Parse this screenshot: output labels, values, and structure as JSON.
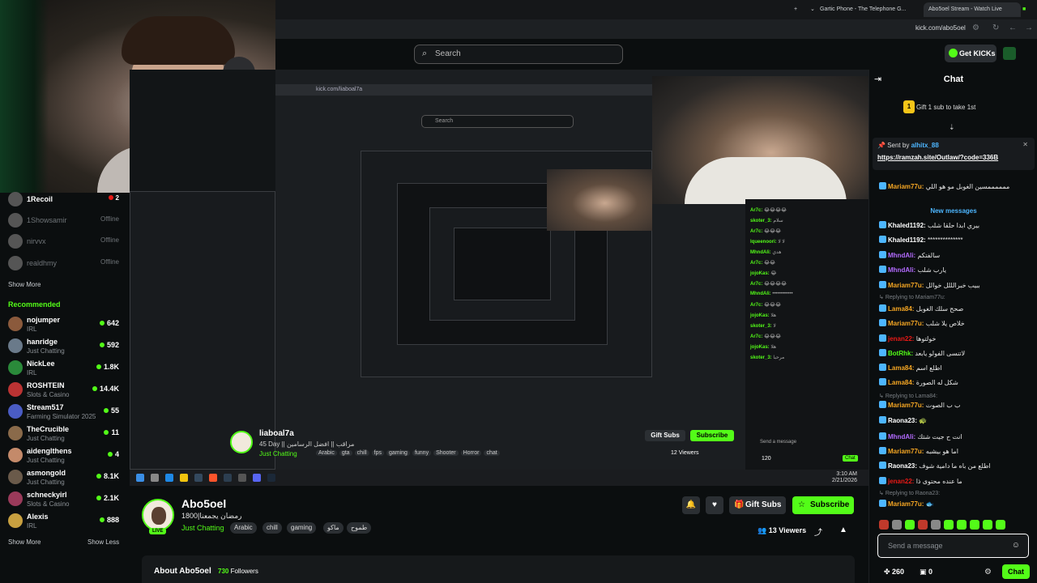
{
  "browser": {
    "tabs": [
      {
        "label": "Gartic Phone - The Telephone G..."
      },
      {
        "label": "Abo5oel Stream - Watch Live"
      }
    ],
    "url": "kick.com/abo5oel"
  },
  "header": {
    "search_placeholder": "Search",
    "get_kicks": "Get KICKs"
  },
  "sidebar": {
    "offline_channels": [
      {
        "name": "1Recoil",
        "viewers": "2"
      },
      {
        "name": "1Showsamir",
        "viewers": "Offline"
      },
      {
        "name": "nirvvx",
        "viewers": "Offline"
      },
      {
        "name": "realdhmy",
        "viewers": "Offline"
      }
    ],
    "show_more_1": "Show More",
    "recommended_label": "Recommended",
    "recommended": [
      {
        "name": "nojumper",
        "category": "IRL",
        "viewers": "642",
        "color": "#8b5a3c"
      },
      {
        "name": "hanridge",
        "category": "Just Chatting",
        "viewers": "592",
        "color": "#6a7a8a"
      },
      {
        "name": "NickLee",
        "category": "IRL",
        "viewers": "1.8K",
        "color": "#2a8a3a"
      },
      {
        "name": "ROSHTEIN",
        "category": "Slots & Casino",
        "viewers": "14.4K",
        "color": "#b33"
      },
      {
        "name": "Stream517",
        "category": "Farming Simulator 2025",
        "viewers": "55",
        "color": "#4a5cc4"
      },
      {
        "name": "TheCrucible",
        "category": "Just Chatting",
        "viewers": "11",
        "color": "#8a6a4a"
      },
      {
        "name": "aidenglthens",
        "category": "Just Chatting",
        "viewers": "4",
        "color": "#c48a6a"
      },
      {
        "name": "asmongold",
        "category": "Just Chatting",
        "viewers": "8.1K",
        "color": "#6a5a4a"
      },
      {
        "name": "schneckyirl",
        "category": "Slots & Casino",
        "viewers": "2.1K",
        "color": "#9a3a5a"
      },
      {
        "name": "Alexis",
        "category": "IRL",
        "viewers": "888",
        "color": "#c8a040"
      }
    ],
    "show_more_2": "Show More",
    "show_less": "Show Less"
  },
  "video": {
    "inner_url": "kick.com/liaboal7a",
    "inner_search": "Search",
    "inner_channel": "liaboal7a",
    "inner_title": "45 Day || مراقب || افضل الرسامين",
    "inner_category": "Just Chatting",
    "inner_tags": [
      "Arabic",
      "gta",
      "chill",
      "fps",
      "gaming",
      "funny",
      "Shooter",
      "Horror",
      "chat"
    ],
    "inner_gift": "Gift Subs",
    "inner_subscribe": "Subscribe",
    "inner_viewers": "12 Viewers",
    "inner_send": "Send a message",
    "inner_points": "120",
    "inner_chat": "Chat",
    "clock_time": "3:10 AM",
    "clock_date": "2/21/2026",
    "mini_chat": [
      {
        "name": "Ar7c:",
        "text": "😂😂😂😂"
      },
      {
        "name": "skoter_3:",
        "text": "سلام"
      },
      {
        "name": "Ar7c:",
        "text": "😂😂😂"
      },
      {
        "name": "lqueenoori:",
        "text": "لا لا"
      },
      {
        "name": "MhndAli:",
        "text": "هدي"
      },
      {
        "name": "Ar7c:",
        "text": "😂😂"
      },
      {
        "name": "jojoKas:",
        "text": "😂"
      },
      {
        "name": "Ar7c:",
        "text": "😂😂😂😂"
      },
      {
        "name": "MhndAli:",
        "text": "••••••••••••"
      },
      {
        "name": "Ar7c:",
        "text": "😂😂😂"
      },
      {
        "name": "jojoKas:",
        "text": "هلا"
      },
      {
        "name": "skoter_3:",
        "text": "لا"
      },
      {
        "name": "Ar7c:",
        "text": "😂😂😂"
      },
      {
        "name": "jojoKas:",
        "text": "هلا"
      },
      {
        "name": "skoter_3:",
        "text": "مرحبا"
      }
    ]
  },
  "channel": {
    "name": "Abo5oel",
    "live": "LIVE",
    "title": "رمضان يجمعنا|1800",
    "category": "Just Chatting",
    "tags": [
      "Arabic",
      "chill",
      "gaming",
      "ماكو",
      "طموح"
    ],
    "gift_subs": "Gift Subs",
    "subscribe": "Subscribe",
    "viewers": "13 Viewers"
  },
  "about": {
    "title": "About Abo5oel",
    "followers_count": "730",
    "followers_label": "Followers"
  },
  "chat": {
    "title": "Chat",
    "gift_badge": "1",
    "gift_banner": "Gift 1 sub to take 1st",
    "pinned_sent_by": "Sent by",
    "pinned_user": "alhitx_88",
    "pinned_link": "https://ramzah.site/Outlaw/?code=336B",
    "new_messages": "New messages",
    "messages": [
      {
        "name": "Mariam77u:",
        "text": "ممممممسين الغوبل مو هو اللي",
        "color": "#f5a623"
      },
      {
        "name": "Khaled1192:",
        "text": "بيري ابدا حلقا شلب",
        "color": "#fff"
      },
      {
        "name": "Khaled1192:",
        "text": "**************",
        "color": "#fff"
      },
      {
        "name": "MhndAli:",
        "text": "سالفتكم",
        "color": "#b36bff"
      },
      {
        "name": "MhndAli:",
        "text": "يارب شلب",
        "color": "#b36bff"
      },
      {
        "name": "Mariam77u:",
        "text": "ببيب خبرالللل خوالل",
        "color": "#f5a623"
      },
      {
        "name": "Lama84:",
        "text": "صحح سلك الغوبل",
        "color": "#f5a623"
      },
      {
        "name": "Mariam77u:",
        "text": "خلاص يلا شلب",
        "color": "#f5a623"
      },
      {
        "name": "jenan22:",
        "text": "خولتوها",
        "color": "#e91916"
      },
      {
        "name": "BotRhk:",
        "text": "لاتنسى الفولو يابعد",
        "color": "#53fc18"
      },
      {
        "name": "Lama84:",
        "text": "اطلع اسم",
        "color": "#f5a623"
      },
      {
        "name": "Lama84:",
        "text": "شكل له الصورة",
        "color": "#f5a623"
      },
      {
        "name": "Mariam77u:",
        "text": "ب ب الصوت",
        "color": "#f5a623"
      },
      {
        "name": "Raona23:",
        "text": "🐢",
        "color": "#fff"
      },
      {
        "name": "MhndAli:",
        "text": "انت ح جيت شتك",
        "color": "#b36bff"
      },
      {
        "name": "Mariam77u:",
        "text": "اما هو بيشبه",
        "color": "#f5a623"
      },
      {
        "name": "Raona23:",
        "text": "اطلع من باه ما دامية شوف",
        "color": "#fff"
      },
      {
        "name": "jenan22:",
        "text": "ما عنده محتوى ذا",
        "color": "#e91916"
      },
      {
        "name": "Mariam77u:",
        "text": "🐟",
        "color": "#f5a623"
      }
    ],
    "reply_1": "Replying to Mariam77u:",
    "reply_2": "Replying to Lama84:",
    "reply_3": "Replying to Raona23:",
    "send_placeholder": "Send a message",
    "points": "260",
    "gifts": "0",
    "send": "Chat"
  }
}
